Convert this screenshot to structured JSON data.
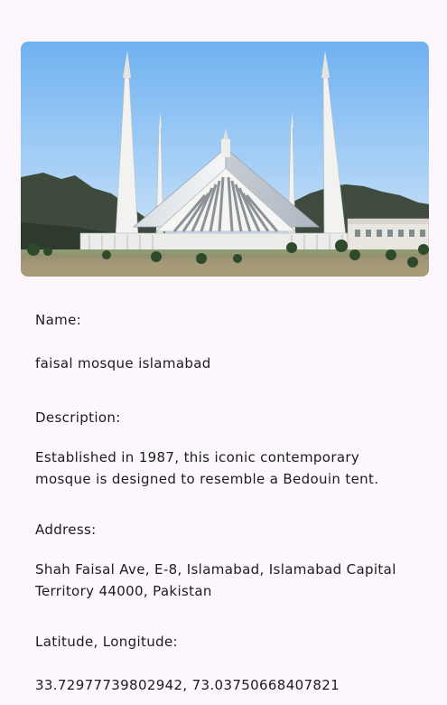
{
  "place": {
    "image_subject": "faisal mosque islamabad photo",
    "name_label": "Name:",
    "name_value": "faisal mosque islamabad",
    "description_label": "Description:",
    "description_value": "Established in 1987, this iconic contemporary mosque is designed to resemble a Bedouin tent.",
    "address_label": "Address:",
    "address_value": "Shah Faisal Ave, E-8, Islamabad, Islamabad Capital Territory 44000, Pakistan",
    "latlng_label": "Latitude, Longitude:",
    "latlng_value": "33.72977739802942, 73.03750668407821"
  }
}
